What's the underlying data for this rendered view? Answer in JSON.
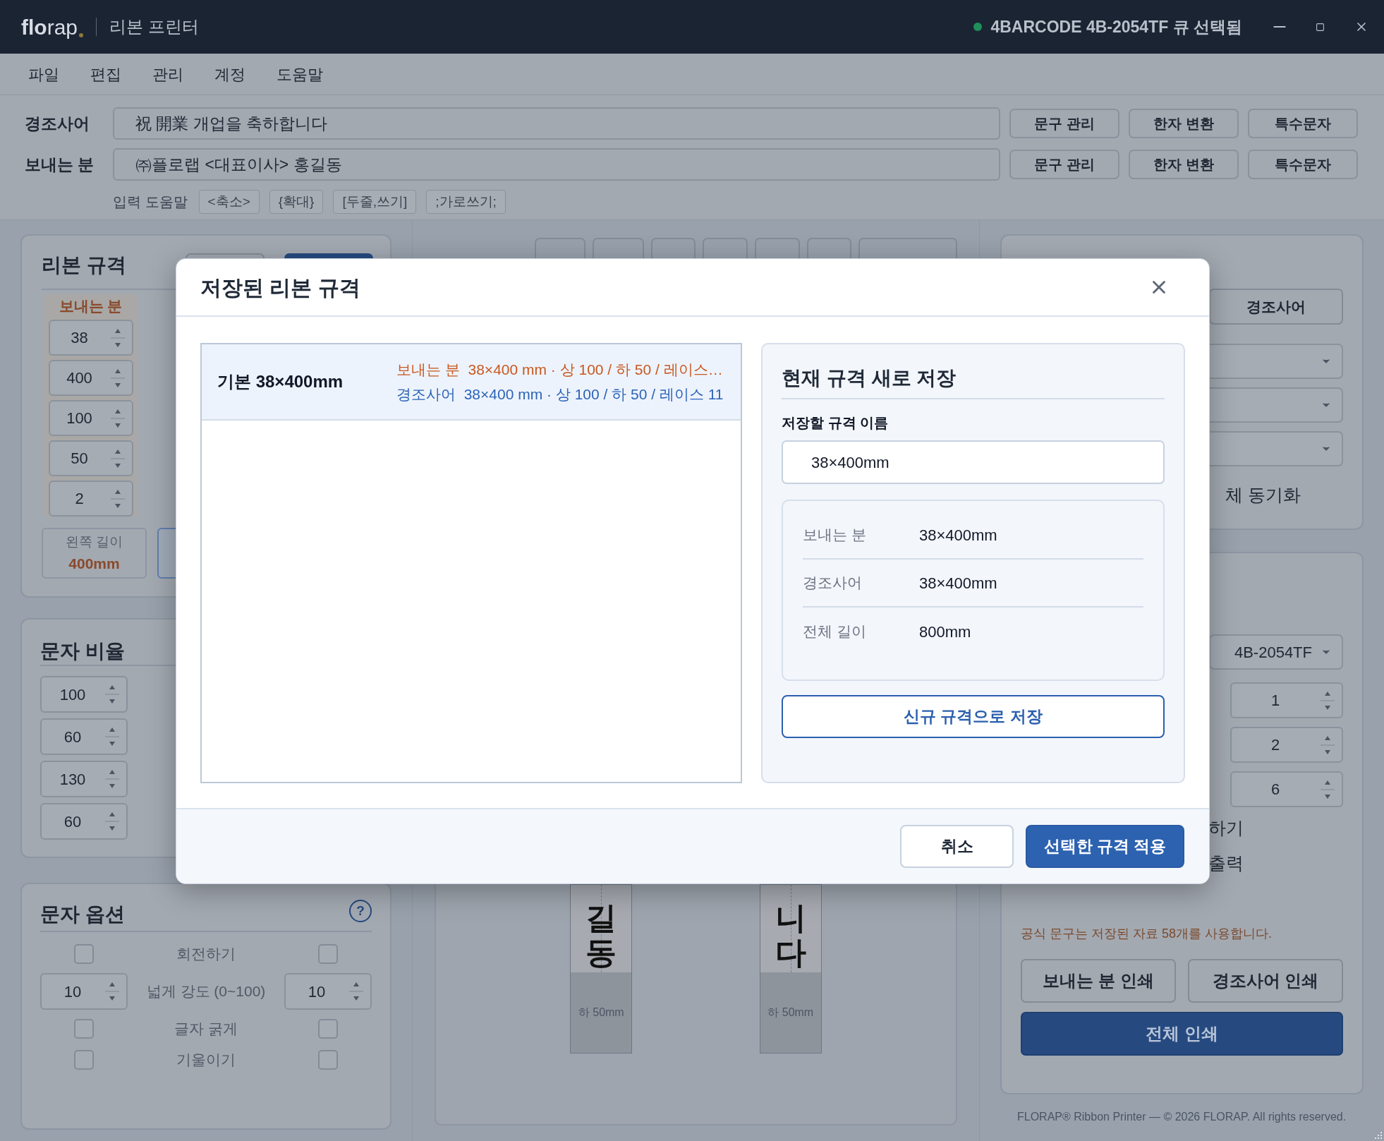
{
  "window": {
    "logo": "**flo**rap",
    "title": "리본 프린터",
    "printer_status": "4BARCODE 4B-2054TF 큐 선택됨",
    "connected": true
  },
  "menu": [
    "파일",
    "편집",
    "관리",
    "계정",
    "도움말"
  ],
  "text_rows": [
    {
      "label": "경조사어",
      "value": "祝 開業 개업을 축하합니다",
      "buttons": [
        "문구 관리",
        "한자 변환",
        "특수문자"
      ]
    },
    {
      "label": "보내는 분",
      "value": "㈜플로랩 <대표이사> 홍길동",
      "buttons": [
        "문구 관리",
        "한자 변환",
        "특수문자"
      ]
    }
  ],
  "input_help": {
    "label": "입력 도움말",
    "chips": [
      "<축소>",
      "{확대}",
      "[두줄,쓰기]",
      ";가로쓰기;"
    ]
  },
  "ribbon_spec": {
    "title": "리본 규격",
    "sender_label": "보내는 분",
    "values": [
      "38",
      "400",
      "100",
      "50",
      "2"
    ],
    "left_length_label": "왼쪽 길이",
    "left_length": "400mm"
  },
  "text_ratio": {
    "title": "문자 비율",
    "values": [
      "100",
      "60",
      "130",
      "60"
    ]
  },
  "text_options": {
    "title": "문자 옵션",
    "help": "?",
    "rows": [
      {
        "kind": "checkbox",
        "label": "회전하기",
        "left_checked": false,
        "right_checked": false
      },
      {
        "kind": "number",
        "label": "넓게 강도 (0~100)",
        "left_value": "10",
        "right_value": "10"
      },
      {
        "kind": "checkbox",
        "label": "글자 굵게",
        "left_checked": false,
        "right_checked": false
      },
      {
        "kind": "checkbox",
        "label": "기울이기",
        "left_checked": false,
        "right_checked": false
      }
    ]
  },
  "preview": {
    "ribbons": [
      {
        "text": "길동",
        "bottom_label": "하 50mm"
      },
      {
        "text": "니다",
        "bottom_label": "하 50mm"
      }
    ]
  },
  "style_panel": {
    "button": "경조사어",
    "sync_label": "체 동기화"
  },
  "print_panel": {
    "printer": "4B-2054TF",
    "copies": [
      "1",
      "2",
      "6"
    ],
    "labels": [
      "하기",
      "출력"
    ],
    "note": "공식 문구는 저장된 자료 58개를 사용합니다.",
    "buttons": [
      {
        "label": "보내는 분 인쇄",
        "primary": false
      },
      {
        "label": "경조사어 인쇄",
        "primary": false
      },
      {
        "label": "전체 인쇄",
        "primary": true
      }
    ]
  },
  "footer": "FLORAP® Ribbon Printer — © 2026 FLORAP. All rights reserved.",
  "dialog": {
    "title": "저장된 리본 규격",
    "presets": [
      {
        "name": "기본 38×400mm",
        "selected": true,
        "sender": "보내는 분  38×400 mm · 상 100 / 하 50 / 레이스…",
        "message": "경조사어  38×400 mm · 상 100 / 하 50 / 레이스 11"
      }
    ],
    "save_new": {
      "title": "현재 규격 새로 저장",
      "name_label": "저장할 규격 이름",
      "name_value": "38×400mm",
      "summary": [
        {
          "label": "보내는 분",
          "value": "38×400mm"
        },
        {
          "label": "경조사어",
          "value": "38×400mm"
        },
        {
          "label": "전체 길이",
          "value": "800mm"
        }
      ],
      "button": "신규 규격으로 저장"
    },
    "buttons": [
      {
        "label": "취소",
        "primary": false
      },
      {
        "label": "선택한 규격 적용",
        "primary": true
      }
    ]
  }
}
